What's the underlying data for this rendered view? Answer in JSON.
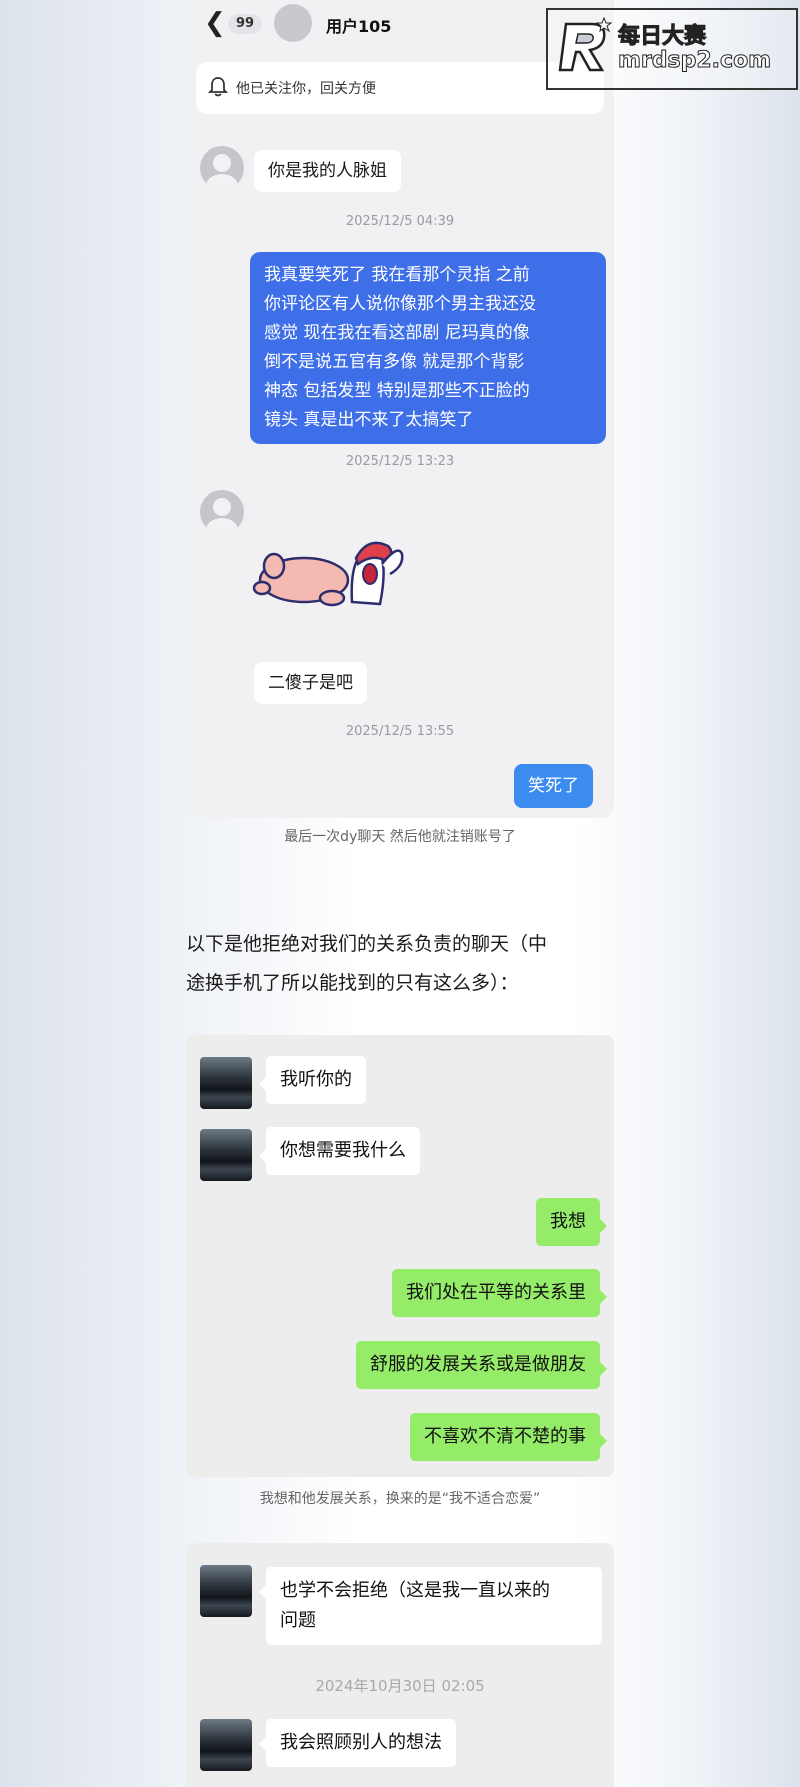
{
  "watermark": {
    "brand": "每日大赛",
    "url": "mrdsp2.com"
  },
  "chat1": {
    "unread_count": "99",
    "contact_name": "用户105",
    "notice": "他已关注你，回关方便",
    "messages": [
      {
        "side": "left",
        "text": "你是我的人脉姐"
      },
      {
        "timestamp": "2025/12/5 04:39"
      },
      {
        "side": "right",
        "lines": [
          "我真要笑死了 我在看那个灵指 之前",
          "你评论区有人说你像那个男主我还没",
          "感觉 现在我在看这部剧 尼玛真的像",
          "倒不是说五官有多像 就是那个背影",
          "神态 包括发型 特别是那些不正脸的",
          "镜头 真是出不来了太搞笑了"
        ]
      },
      {
        "timestamp": "2025/12/5 13:23"
      },
      {
        "side": "left",
        "sticker": "laughing-sticker"
      },
      {
        "side": "left",
        "text": "二傻子是吧"
      },
      {
        "timestamp": "2025/12/5 13:55"
      },
      {
        "side": "right",
        "text": "笑死了"
      }
    ],
    "caption": "最后一次dy聊天 然后他就注销账号了"
  },
  "paragraph": {
    "line1": "以下是他拒绝对我们的关系负责的聊天（中",
    "line2": "途换手机了所以能找到的只有这么多）："
  },
  "chat2": {
    "messages": [
      {
        "side": "left",
        "text": "我听你的"
      },
      {
        "side": "left",
        "text": "你想需要我什么"
      },
      {
        "side": "right",
        "text": "我想"
      },
      {
        "side": "right",
        "text": "我们处在平等的关系里"
      },
      {
        "side": "right",
        "text": "舒服的发展关系或是做朋友"
      },
      {
        "side": "right",
        "text": "不喜欢不清不楚的事"
      }
    ],
    "caption": "我想和他发展关系，换来的是“我不适合恋爱”"
  },
  "chat3": {
    "messages": [
      {
        "side": "left",
        "lines": [
          "也学不会拒绝（这是我一直以来的",
          "问题"
        ]
      },
      {
        "timestamp": "2024年10月30日 02:05"
      },
      {
        "side": "left",
        "text": "我会照顾别人的想法"
      }
    ]
  },
  "colors": {
    "douyin_blue": "#3f6fe8",
    "wechat_green": "#95ec69",
    "chat_bg": "#f1f1f4"
  }
}
